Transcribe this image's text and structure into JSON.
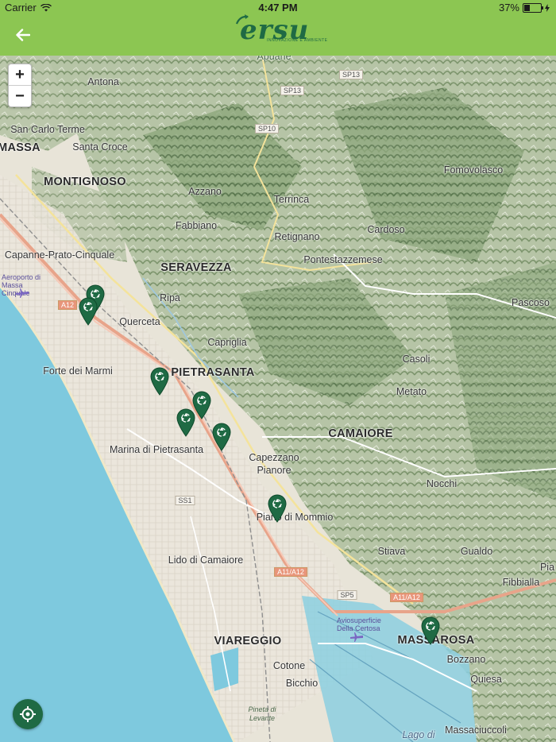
{
  "status": {
    "carrier": "Carrier",
    "time": "4:47 PM",
    "battery": "37%",
    "battery_level": 0.37
  },
  "nav": {
    "logo_text": "ersu",
    "logo_tagline": "INNOVAZIONE E AMBIENTE",
    "back_icon": "arrow-left-icon"
  },
  "colors": {
    "header": "#8cc652",
    "brand": "#1f6a44",
    "sea": "#7ec9de"
  },
  "map": {
    "zoom_in": "+",
    "zoom_out": "−",
    "places": {
      "apuane": "Apuane",
      "antona": "Antona",
      "san_carlo": "San Carlo Terme",
      "massa": "MASSA",
      "santa_croce": "Santa Croce",
      "montignoso": "MONTIGNOSO",
      "azzano": "Azzano",
      "terrinca": "Terrinca",
      "fomovolasco": "Fomovolasco",
      "fabbiano": "Fabbiano",
      "cardoso": "Cardoso",
      "retignano": "Retignano",
      "pontestazzemese": "Pontestazzemese",
      "capanne": "Capanne-Prato-Cinquale",
      "seravezza": "SERAVEZZA",
      "aeroporto": "Aeroporto di Massa Cinquale",
      "ripa": "Ripa",
      "pascoso": "Pascoso",
      "querceta": "Querceta",
      "capriglia": "Capriglia",
      "forte": "Forte dei Marmi",
      "pietrasanta": "PIETRASANTA",
      "casoli": "Casoli",
      "metato": "Metato",
      "camaiore": "CAMAIORE",
      "marina": "Marina di Pietrasanta",
      "capezzano": "Capezzano Pianore",
      "nocchi": "Nocchi",
      "piano": "Piano di Mommio",
      "gualdo": "Gualdo",
      "stiava": "Stiava",
      "lido": "Lido di Camaiore",
      "fibbiala": "Fibbialla",
      "pia": "Pia",
      "aviosuperficie": "Aviosuperficie Della Certosa",
      "viareggio": "VIAREGGIO",
      "massarosa": "MASSAROSA",
      "bozzano": "Bozzano",
      "cotone": "Cotone",
      "quiesa": "Quiesa",
      "bicchio": "Bicchio",
      "pineta": "Pineta di Levante",
      "lago": "Lago di",
      "massaciuccoli": "Massaciuccoli"
    },
    "roads": {
      "sp13": "SP13",
      "sp13b": "SP13",
      "sp10": "SP10",
      "a12": "A12",
      "ss1": "SS1",
      "a11a12": "A11/A12",
      "sp5": "SP5",
      "a11a12b": "A11/A12"
    },
    "pin_icon": "recycle-pin-icon",
    "locate_icon": "crosshair-icon"
  }
}
